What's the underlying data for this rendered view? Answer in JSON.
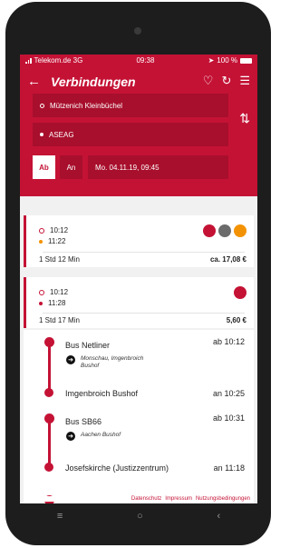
{
  "status_bar": {
    "carrier": "Telekom.de 3G",
    "time": "09:38",
    "battery": "100 %"
  },
  "header": {
    "title": "Verbindungen",
    "back_icon": "arrow-left",
    "fav_icon": "heart",
    "refresh_icon": "refresh",
    "filter_icon": "filter"
  },
  "search": {
    "from": "Mützenich Kleinbüchel",
    "to": "ASEAG",
    "mode_departure": "Ab",
    "mode_arrival": "An",
    "datetime": "Mo. 04.11.19, 09:45"
  },
  "connections": [
    {
      "dep": "10:12",
      "arr": "11:22",
      "duration": "1 Std 12 Min",
      "price": "ca. 17,08 €",
      "colors": [
        "#c41235",
        "#6b6b6b",
        "#f39200"
      ]
    },
    {
      "dep": "10:12",
      "arr": "11:28",
      "duration": "1 Std 17 Min",
      "price": "5,60 €",
      "colors": [
        "#c41235"
      ]
    }
  ],
  "legs": [
    {
      "line": "Bus Netliner",
      "dep_time": "ab 10:12",
      "direction": "Monschau, Imgenbroich Bushof",
      "stop": "Imgenbroich Bushof",
      "arr_time": "an 10:25"
    },
    {
      "line": "Bus SB66",
      "dep_time": "ab 10:31",
      "direction": "Aachen Bushof",
      "stop": "Josefskirche (Justizzentrum)",
      "arr_time": "an 11:18"
    }
  ],
  "footer": {
    "privacy": "Datenschutz",
    "imprint": "Impressum",
    "terms": "Nutzungsbedingungen"
  },
  "nav": {
    "menu": "≡",
    "home": "○",
    "back": "‹"
  },
  "colors": {
    "brand": "#c41235",
    "brand_dark": "#a80f2c"
  }
}
